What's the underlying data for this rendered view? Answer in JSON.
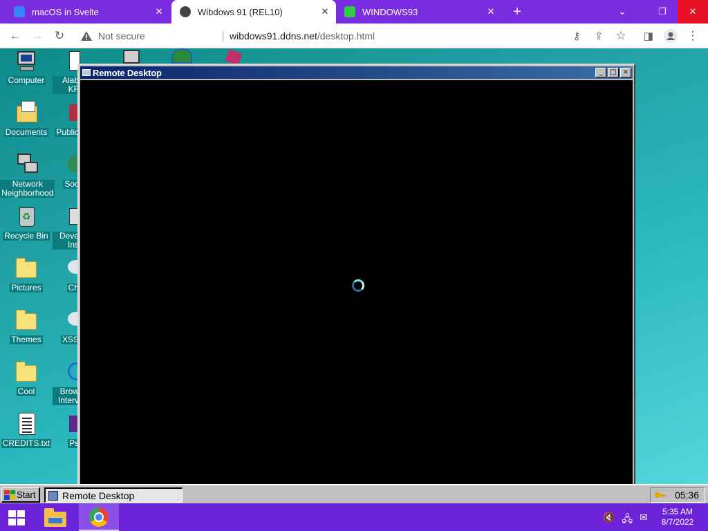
{
  "browser": {
    "tabs": [
      {
        "title": "macOS in Svelte",
        "active": false,
        "favicon_color": "#3b82f6"
      },
      {
        "title": "Wibdows 91 (REL10)",
        "active": true,
        "favicon_color": "#333333"
      },
      {
        "title": "WINDOWS93",
        "active": false,
        "favicon_color": "#2ecc40"
      }
    ],
    "security_label": "Not secure",
    "url_host": "wibdows91.ddns.net",
    "url_path": "/desktop.html",
    "accent": "#7a2de0"
  },
  "desktop": {
    "icons_left": [
      {
        "label": "Computer",
        "kind": "computer"
      },
      {
        "label": "Documents",
        "kind": "documents"
      },
      {
        "label": "Network Neighborhood",
        "kind": "network"
      },
      {
        "label": "Recycle Bin",
        "kind": "recycle"
      },
      {
        "label": "Pictures",
        "kind": "folder"
      },
      {
        "label": "Themes",
        "kind": "folder"
      },
      {
        "label": "Cool",
        "kind": "folder"
      },
      {
        "label": "CREDITS.txt",
        "kind": "text"
      }
    ],
    "icons_partial": [
      "Alab KF",
      "Public",
      "Soc",
      "Deve Ins",
      "Ch",
      "XSS",
      "Brow Interv",
      "Ps"
    ]
  },
  "remote_window": {
    "title": "Remote Desktop",
    "buttons": [
      "_",
      "□",
      "×"
    ]
  },
  "taskbar": {
    "start_label": "Start",
    "task_item": "Remote Desktop",
    "clock": "05:36"
  },
  "host_taskbar": {
    "time": "5:35 AM",
    "date": "8/7/2022"
  }
}
